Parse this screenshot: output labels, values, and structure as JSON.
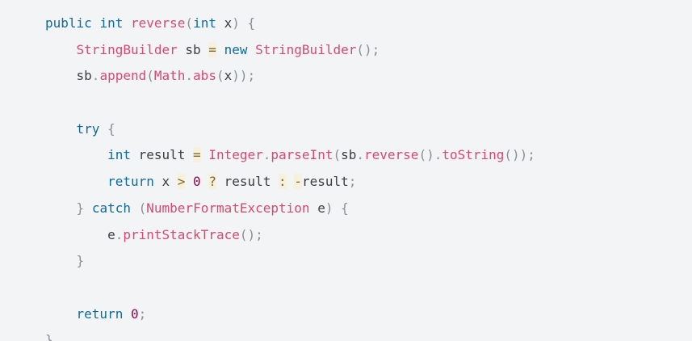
{
  "code": {
    "language": "java",
    "lines": [
      [
        {
          "t": "public",
          "c": "kw"
        },
        {
          "t": " ",
          "c": "id"
        },
        {
          "t": "int",
          "c": "kw"
        },
        {
          "t": " ",
          "c": "id"
        },
        {
          "t": "reverse",
          "c": "fn"
        },
        {
          "t": "(",
          "c": "punc"
        },
        {
          "t": "int",
          "c": "kw"
        },
        {
          "t": " x",
          "c": "id"
        },
        {
          "t": ")",
          "c": "punc"
        },
        {
          "t": " ",
          "c": "id"
        },
        {
          "t": "{",
          "c": "punc"
        }
      ],
      [
        {
          "t": "    ",
          "c": "id"
        },
        {
          "t": "StringBuilder",
          "c": "cls"
        },
        {
          "t": " sb ",
          "c": "id"
        },
        {
          "t": "=",
          "c": "op"
        },
        {
          "t": " ",
          "c": "id"
        },
        {
          "t": "new",
          "c": "kw"
        },
        {
          "t": " ",
          "c": "id"
        },
        {
          "t": "StringBuilder",
          "c": "cls"
        },
        {
          "t": "();",
          "c": "punc"
        }
      ],
      [
        {
          "t": "    sb",
          "c": "id"
        },
        {
          "t": ".",
          "c": "punc"
        },
        {
          "t": "append",
          "c": "fn"
        },
        {
          "t": "(",
          "c": "punc"
        },
        {
          "t": "Math",
          "c": "cls"
        },
        {
          "t": ".",
          "c": "punc"
        },
        {
          "t": "abs",
          "c": "fn"
        },
        {
          "t": "(",
          "c": "punc"
        },
        {
          "t": "x",
          "c": "id"
        },
        {
          "t": "));",
          "c": "punc"
        }
      ],
      [],
      [
        {
          "t": "    ",
          "c": "id"
        },
        {
          "t": "try",
          "c": "kw"
        },
        {
          "t": " ",
          "c": "id"
        },
        {
          "t": "{",
          "c": "punc"
        }
      ],
      [
        {
          "t": "        ",
          "c": "id"
        },
        {
          "t": "int",
          "c": "kw"
        },
        {
          "t": " result ",
          "c": "id"
        },
        {
          "t": "=",
          "c": "op"
        },
        {
          "t": " ",
          "c": "id"
        },
        {
          "t": "Integer",
          "c": "cls"
        },
        {
          "t": ".",
          "c": "punc"
        },
        {
          "t": "parseInt",
          "c": "fn"
        },
        {
          "t": "(",
          "c": "punc"
        },
        {
          "t": "sb",
          "c": "id"
        },
        {
          "t": ".",
          "c": "punc"
        },
        {
          "t": "reverse",
          "c": "fn"
        },
        {
          "t": "().",
          "c": "punc"
        },
        {
          "t": "toString",
          "c": "fn"
        },
        {
          "t": "());",
          "c": "punc"
        }
      ],
      [
        {
          "t": "        ",
          "c": "id"
        },
        {
          "t": "return",
          "c": "kw"
        },
        {
          "t": " x ",
          "c": "id"
        },
        {
          "t": ">",
          "c": "op"
        },
        {
          "t": " ",
          "c": "id"
        },
        {
          "t": "0",
          "c": "num"
        },
        {
          "t": " ",
          "c": "id"
        },
        {
          "t": "?",
          "c": "op"
        },
        {
          "t": " result ",
          "c": "id"
        },
        {
          "t": ":",
          "c": "op"
        },
        {
          "t": " ",
          "c": "id"
        },
        {
          "t": "-",
          "c": "op"
        },
        {
          "t": "result",
          "c": "id"
        },
        {
          "t": ";",
          "c": "punc"
        }
      ],
      [
        {
          "t": "    ",
          "c": "id"
        },
        {
          "t": "}",
          "c": "punc"
        },
        {
          "t": " ",
          "c": "id"
        },
        {
          "t": "catch",
          "c": "kw"
        },
        {
          "t": " ",
          "c": "id"
        },
        {
          "t": "(",
          "c": "punc"
        },
        {
          "t": "NumberFormatException",
          "c": "cls"
        },
        {
          "t": " e",
          "c": "id"
        },
        {
          "t": ")",
          "c": "punc"
        },
        {
          "t": " ",
          "c": "id"
        },
        {
          "t": "{",
          "c": "punc"
        }
      ],
      [
        {
          "t": "        e",
          "c": "id"
        },
        {
          "t": ".",
          "c": "punc"
        },
        {
          "t": "printStackTrace",
          "c": "fn"
        },
        {
          "t": "();",
          "c": "punc"
        }
      ],
      [
        {
          "t": "    ",
          "c": "id"
        },
        {
          "t": "}",
          "c": "punc"
        }
      ],
      [],
      [
        {
          "t": "    ",
          "c": "id"
        },
        {
          "t": "return",
          "c": "kw"
        },
        {
          "t": " ",
          "c": "id"
        },
        {
          "t": "0",
          "c": "num"
        },
        {
          "t": ";",
          "c": "punc"
        }
      ],
      [
        {
          "t": "}",
          "c": "punc"
        }
      ]
    ]
  }
}
